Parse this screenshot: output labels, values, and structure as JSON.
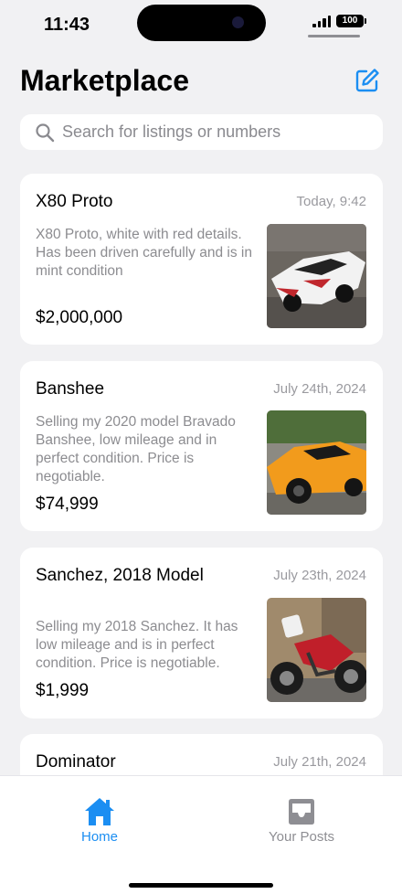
{
  "status": {
    "time": "11:43",
    "battery": "100"
  },
  "header": {
    "title": "Marketplace"
  },
  "search": {
    "placeholder": "Search for listings or numbers"
  },
  "listings": [
    {
      "title": "X80 Proto",
      "date": "Today, 9:42",
      "description": "X80 Proto, white with red details. Has been driven carefully and is in mint condition",
      "price": "$2,000,000"
    },
    {
      "title": "Banshee",
      "date": "July 24th, 2024",
      "description": "Selling my 2020 model Bravado Banshee, low mileage and in perfect condition. Price is negotiable.",
      "price": "$74,999"
    },
    {
      "title": "Sanchez, 2018 Model",
      "date": "July 23th, 2024",
      "description": "Selling my 2018 Sanchez. It has low mileage and is in perfect condition. Price is negotiable.",
      "price": "$1,999"
    },
    {
      "title": "Dominator",
      "date": "July 21th, 2024"
    }
  ],
  "tabs": [
    {
      "label": "Home",
      "icon": "home-icon",
      "active": true
    },
    {
      "label": "Your Posts",
      "icon": "tray-icon",
      "active": false
    }
  ],
  "colors": {
    "accent": "#1b8ef2",
    "background": "#f1f1f3",
    "inactive": "#8e8e93"
  }
}
